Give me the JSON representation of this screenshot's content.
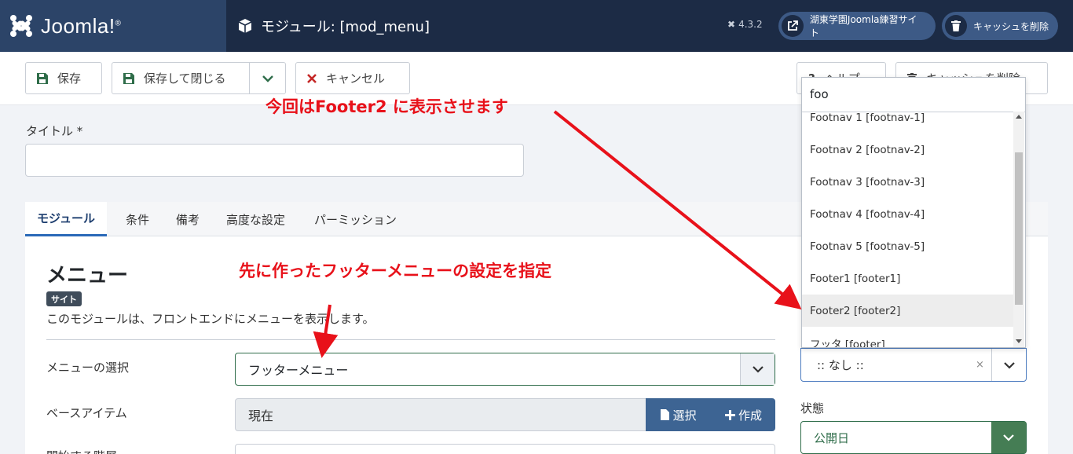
{
  "header": {
    "logo_text": "Joomla!",
    "logo_reg": "®",
    "page_title": "モジュール: [mod_menu]",
    "version": "4.3.2",
    "site_button": "湖東学園Joomla練習サイト",
    "cache_button": "キャッシュを削除"
  },
  "toolbar": {
    "save": "保存",
    "save_close": "保存して閉じる",
    "cancel": "キャンセル",
    "help": "ヘルプ",
    "clear_cache": "キャッシュを削除"
  },
  "form": {
    "title_label": "タイトル *",
    "title_value": ""
  },
  "tabs": [
    "モジュール",
    "条件",
    "備考",
    "高度な設定",
    "パーミッション"
  ],
  "module": {
    "heading": "メニュー",
    "badge": "サイト",
    "description": "このモジュールは、フロントエンドにメニューを表示します。",
    "menu_select_label": "メニューの選択",
    "menu_select_value": "フッターメニュー",
    "base_item_label": "ベースアイテム",
    "base_item_value": "現在",
    "select_button": "選択",
    "create_button": "作成",
    "start_level_label": "開始する階層"
  },
  "position": {
    "search_value": "foo",
    "options": [
      "Footnav 1 [footnav-1]",
      "Footnav 2 [footnav-2]",
      "Footnav 3 [footnav-3]",
      "Footnav 4 [footnav-4]",
      "Footnav 5 [footnav-5]",
      "Footer1 [footer1]",
      "Footer2 [footer2]",
      "フッタ [footer]"
    ],
    "highlighted_index": 6,
    "current_value": ":: なし ::",
    "clear_symbol": "×"
  },
  "state": {
    "label": "状態",
    "value": "公開日"
  },
  "annotations": {
    "top": "今回はFooter2 に表示させます",
    "middle": "先に作ったフッターメニューの設定を指定"
  },
  "colors": {
    "header_bg": "#1c2b45",
    "logo_bg": "#2c4468",
    "accent_green": "#2f6d4a",
    "accent_blue": "#3d6493",
    "annotation_red": "#e8111a"
  }
}
